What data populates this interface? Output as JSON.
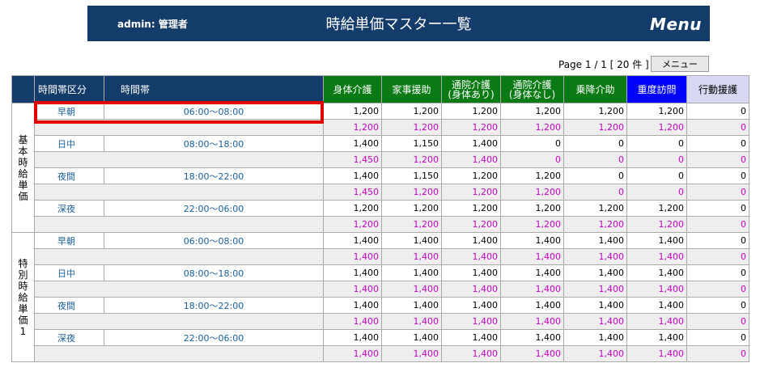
{
  "header": {
    "user": "admin: 管理者",
    "title": "時給単価マスター一覧",
    "menu_label": "Menu"
  },
  "pager": {
    "text": "Page 1 / 1 [ 20 件 ]",
    "menu_button": "メニュー"
  },
  "table": {
    "col_group": "時間帯区分",
    "col_time": "時間帯",
    "service_headers": [
      "身体介護",
      "家事援助",
      "通院介護\n(身体あり)",
      "通院介護\n(身体なし)",
      "乗降介助",
      "重度訪問",
      "行動援護"
    ],
    "colors": {
      "navy": "#143c6b",
      "green": "#0a7a14",
      "blue": "#0000ff",
      "lavender": "#d8d8f4",
      "pink": "#c800c8",
      "highlight": "#e00000"
    },
    "groups": [
      {
        "label": "基本時給単価",
        "slots": [
          {
            "name": "早朝",
            "time": "06:00〜08:00",
            "main": [
              "1,200",
              "1,200",
              "1,200",
              "1,200",
              "1,200",
              "1,200",
              "0"
            ],
            "sub": [
              "1,200",
              "1,200",
              "1,200",
              "1,200",
              "1,200",
              "1,200",
              "0"
            ]
          },
          {
            "name": "日中",
            "time": "08:00〜18:00",
            "main": [
              "1,400",
              "1,150",
              "1,400",
              "0",
              "0",
              "0",
              "0"
            ],
            "sub": [
              "1,450",
              "1,200",
              "1,400",
              "0",
              "0",
              "0",
              "0"
            ]
          },
          {
            "name": "夜間",
            "time": "18:00〜22:00",
            "main": [
              "1,400",
              "1,150",
              "1,200",
              "1,200",
              "0",
              "0",
              "0"
            ],
            "sub": [
              "1,450",
              "1,200",
              "1,200",
              "1,200",
              "0",
              "0",
              "0"
            ]
          },
          {
            "name": "深夜",
            "time": "22:00〜06:00",
            "main": [
              "1,200",
              "1,200",
              "1,200",
              "1,200",
              "1,200",
              "1,200",
              "0"
            ],
            "sub": [
              "1,200",
              "1,200",
              "1,200",
              "1,200",
              "1,200",
              "1,200",
              "0"
            ]
          }
        ]
      },
      {
        "label": "特別時給単価1",
        "slots": [
          {
            "name": "早朝",
            "time": "06:00〜08:00",
            "main": [
              "1,400",
              "1,400",
              "1,400",
              "1,400",
              "1,400",
              "1,400",
              "0"
            ],
            "sub": [
              "1,400",
              "1,400",
              "1,400",
              "1,400",
              "1,400",
              "1,400",
              "0"
            ]
          },
          {
            "name": "日中",
            "time": "08:00〜18:00",
            "main": [
              "1,400",
              "1,400",
              "1,400",
              "1,400",
              "1,400",
              "1,400",
              "0"
            ],
            "sub": [
              "1,400",
              "1,400",
              "1,400",
              "1,400",
              "1,400",
              "1,400",
              "0"
            ]
          },
          {
            "name": "夜間",
            "time": "18:00〜22:00",
            "main": [
              "1,400",
              "1,400",
              "1,400",
              "1,400",
              "1,400",
              "1,400",
              "0"
            ],
            "sub": [
              "1,400",
              "1,400",
              "1,400",
              "1,400",
              "1,400",
              "1,400",
              "0"
            ]
          },
          {
            "name": "深夜",
            "time": "22:00〜06:00",
            "main": [
              "1,400",
              "1,400",
              "1,400",
              "1,400",
              "1,400",
              "1,400",
              "0"
            ],
            "sub": [
              "1,400",
              "1,400",
              "1,400",
              "1,400",
              "1,400",
              "1,400",
              "0"
            ]
          }
        ]
      }
    ]
  }
}
